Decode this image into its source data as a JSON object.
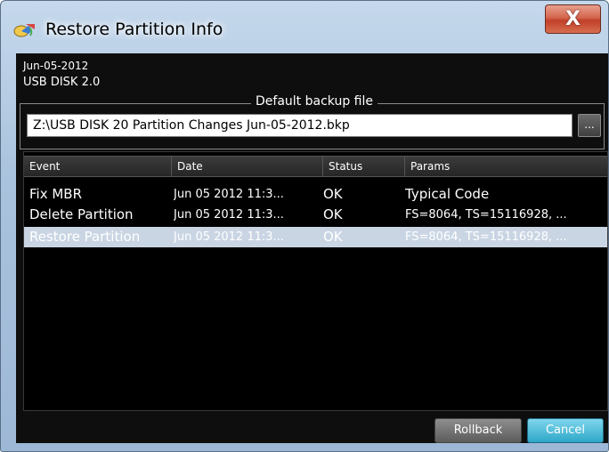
{
  "window": {
    "title": "Restore Partition Info",
    "close_label": "X"
  },
  "info": {
    "date": "Jun-05-2012",
    "disk": "USB DISK 2.0"
  },
  "backup": {
    "group_label": "Default backup file",
    "path": "Z:\\USB DISK 20 Partition Changes Jun-05-2012.bkp",
    "browse_label": "..."
  },
  "table": {
    "columns": [
      "Event",
      "Date",
      "Status",
      "Params"
    ],
    "rows": [
      {
        "event": "Fix MBR",
        "date": "Jun 05 2012 11:3...",
        "status": "OK",
        "params": "Typical Code",
        "selected": false
      },
      {
        "event": "Delete Partition",
        "date": "Jun 05 2012 11:3...",
        "status": "OK",
        "params": "FS=8064, TS=15116928, ...",
        "selected": false
      },
      {
        "event": "Restore Partition",
        "date": "Jun 05 2012 11:3...",
        "status": "OK",
        "params": "FS=8064, TS=15116928, ...",
        "selected": true
      }
    ]
  },
  "buttons": {
    "rollback": "Rollback",
    "cancel": "Cancel"
  },
  "colors": {
    "accent": "#2fa7c9",
    "close": "#c2402a",
    "selection": "#c9d5e3"
  },
  "icons": {
    "app": "restore-partition-icon",
    "close": "close-icon"
  }
}
